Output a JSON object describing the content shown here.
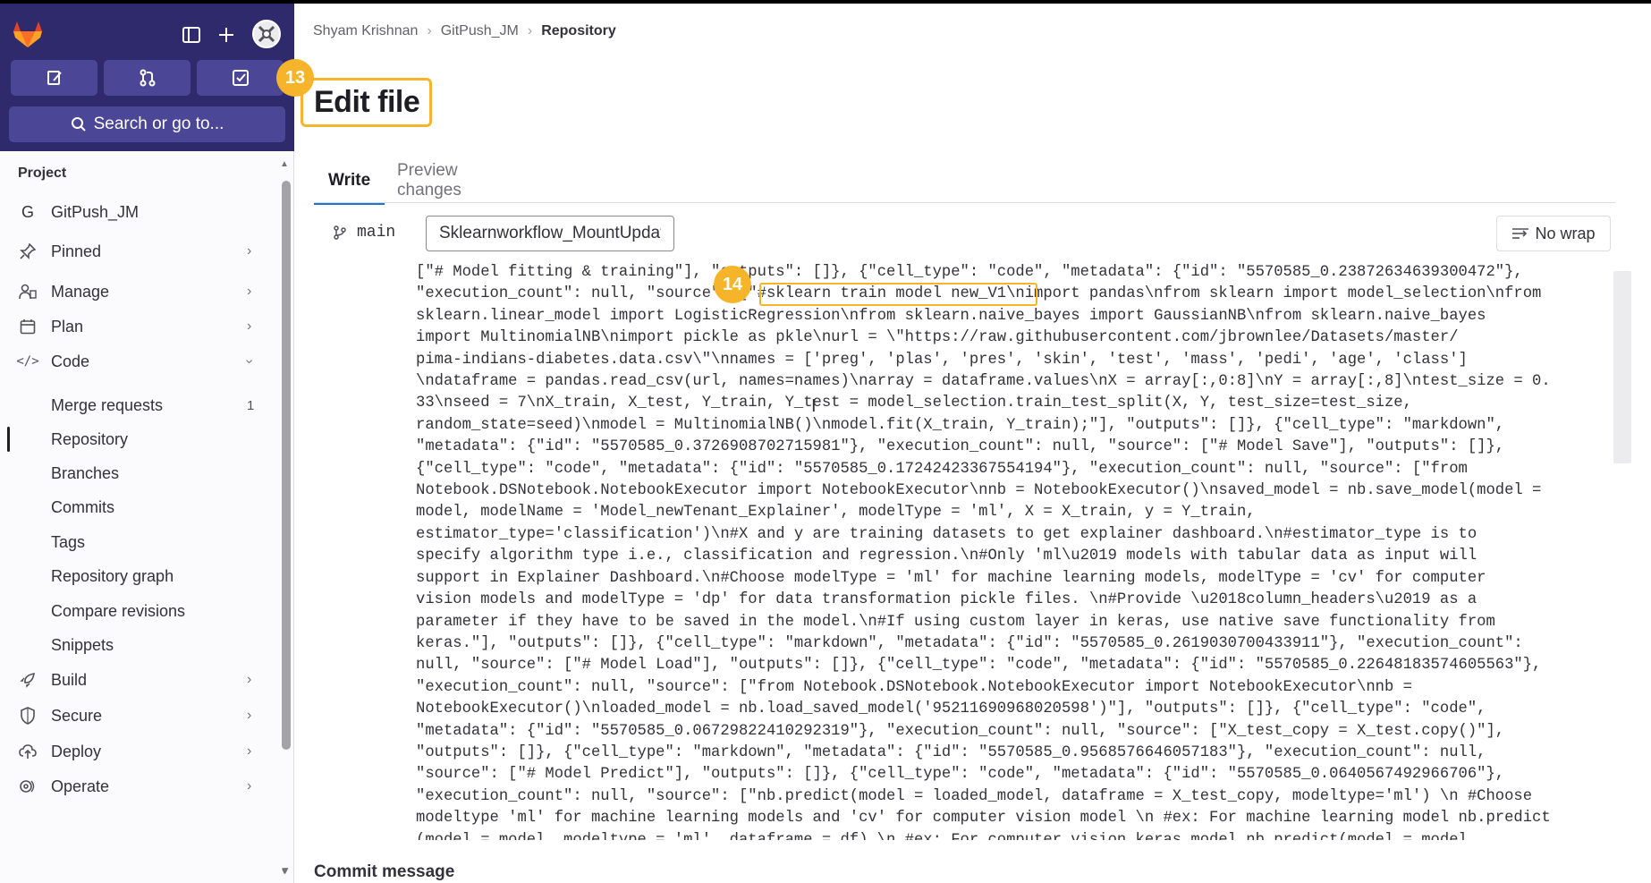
{
  "sidebar": {
    "search_label": "Search or go to...",
    "section_title": "Project",
    "project_initial": "G",
    "items": [
      {
        "key": "project",
        "label": "GitPush_JM"
      },
      {
        "key": "pinned",
        "label": "Pinned"
      },
      {
        "key": "manage",
        "label": "Manage"
      },
      {
        "key": "plan",
        "label": "Plan"
      },
      {
        "key": "code",
        "label": "Code"
      },
      {
        "key": "merge_requests",
        "label": "Merge requests",
        "count": "1"
      },
      {
        "key": "repository",
        "label": "Repository"
      },
      {
        "key": "branches",
        "label": "Branches"
      },
      {
        "key": "commits",
        "label": "Commits"
      },
      {
        "key": "tags",
        "label": "Tags"
      },
      {
        "key": "repository_graph",
        "label": "Repository graph"
      },
      {
        "key": "compare_revisions",
        "label": "Compare revisions"
      },
      {
        "key": "snippets",
        "label": "Snippets"
      },
      {
        "key": "build",
        "label": "Build"
      },
      {
        "key": "secure",
        "label": "Secure"
      },
      {
        "key": "deploy",
        "label": "Deploy"
      },
      {
        "key": "operate",
        "label": "Operate"
      }
    ]
  },
  "breadcrumb": [
    "Shyam Krishnan",
    "GitPush_JM",
    "Repository"
  ],
  "title": "Edit file",
  "callouts": {
    "step_title": "13",
    "step_code": "14"
  },
  "tabs": [
    "Write",
    "Preview changes"
  ],
  "branch": "main",
  "filename": "Sklearnworkflow_MountUpdate",
  "no_wrap": "No wrap",
  "code_lines": [
    "[\"# Model fitting & training\"], \"outputs\": []}, {\"cell_type\": \"code\", \"metadata\": {\"id\": \"5570585_0.23872634639300472\"},",
    "\"execution_count\": null, \"source\": [\"#sklearn train model new_V1\\nimport pandas\\nfrom sklearn import model_selection\\nfrom",
    "sklearn.linear_model import LogisticRegression\\nfrom sklearn.naive_bayes import GaussianNB\\nfrom sklearn.naive_bayes",
    "import MultinomialNB\\nimport pickle as pkle\\nurl = \\\"https://raw.githubusercontent.com/jbrownlee/Datasets/master/",
    "pima-indians-diabetes.data.csv\\\"\\nnames = ['preg', 'plas', 'pres', 'skin', 'test', 'mass', 'pedi', 'age', 'class']",
    "\\ndataframe = pandas.read_csv(url, names=names)\\narray = dataframe.values\\nX = array[:,0:8]\\nY = array[:,8]\\ntest_size = 0.",
    "33\\nseed = 7\\nX_train, X_test, Y_train, Y_test = model_selection.train_test_split(X, Y, test_size=test_size,",
    "random_state=seed)\\nmodel = MultinomialNB()\\nmodel.fit(X_train, Y_train);\"], \"outputs\": []}, {\"cell_type\": \"markdown\",",
    "\"metadata\": {\"id\": \"5570585_0.3726908702715981\"}, \"execution_count\": null, \"source\": [\"# Model Save\"], \"outputs\": []},",
    "{\"cell_type\": \"code\", \"metadata\": {\"id\": \"5570585_0.17242423367554194\"}, \"execution_count\": null, \"source\": [\"from",
    "Notebook.DSNotebook.NotebookExecutor import NotebookExecutor\\nnb = NotebookExecutor()\\nsaved_model = nb.save_model(model =",
    "model, modelName = 'Model_newTenant_Explainer', modelType = 'ml', X = X_train, y = Y_train,",
    "estimator_type='classification')\\n#X and y are training datasets to get explainer dashboard.\\n#estimator_type is to",
    "specify algorithm type i.e., classification and regression.\\n#Only 'ml\\u2019 models with tabular data as input will",
    "support in Explainer Dashboard.\\n#Choose modelType = 'ml' for machine learning models, modelType = 'cv' for computer",
    "vision models and modelType = 'dp' for data transformation pickle files. \\n#Provide \\u2018column_headers\\u2019 as a",
    "parameter if they have to be saved in the model.\\n#If using custom layer in keras, use native save functionality from",
    "keras.\"], \"outputs\": []}, {\"cell_type\": \"markdown\", \"metadata\": {\"id\": \"5570585_0.2619030700433911\"}, \"execution_count\":",
    "null, \"source\": [\"# Model Load\"], \"outputs\": []}, {\"cell_type\": \"code\", \"metadata\": {\"id\": \"5570585_0.22648183574605563\"},",
    "\"execution_count\": null, \"source\": [\"from Notebook.DSNotebook.NotebookExecutor import NotebookExecutor\\nnb =",
    "NotebookExecutor()\\nloaded_model = nb.load_saved_model('95211690968020598')\"], \"outputs\": []}, {\"cell_type\": \"code\",",
    "\"metadata\": {\"id\": \"5570585_0.06729822410292319\"}, \"execution_count\": null, \"source\": [\"X_test_copy = X_test.copy()\"],",
    "\"outputs\": []}, {\"cell_type\": \"markdown\", \"metadata\": {\"id\": \"5570585_0.9568576646057183\"}, \"execution_count\": null,",
    "\"source\": [\"# Model Predict\"], \"outputs\": []}, {\"cell_type\": \"code\", \"metadata\": {\"id\": \"5570585_0.0640567492966706\"},",
    "\"execution_count\": null, \"source\": [\"nb.predict(model = loaded_model, dataframe = X_test_copy, modeltype='ml') \\n #Choose",
    "modeltype 'ml' for machine learning models and 'cv' for computer vision model \\n #ex: For machine learning model nb.predict",
    "(model = model, modeltype = 'ml', dataframe = df) \\n #ex: For computer vision keras model nb.predict(model = model,"
  ],
  "commit_message_label": "Commit message",
  "colors": {
    "sidebar_header": "#2f2a6b",
    "callout": "#f6b42a",
    "tab_underline": "#1f75cb"
  }
}
